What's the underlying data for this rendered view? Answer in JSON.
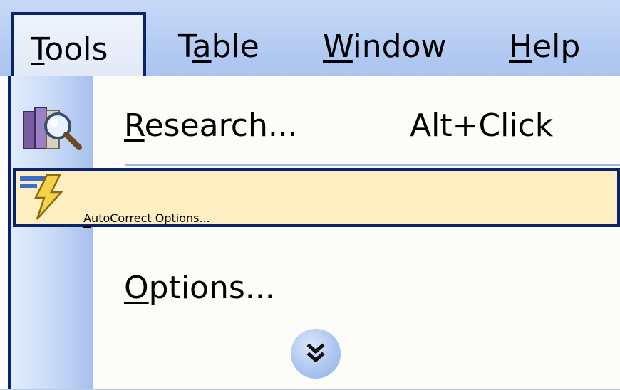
{
  "menubar": {
    "items": [
      {
        "label_pre": "",
        "label_mnemonic": "T",
        "label_post": "ools",
        "active": true
      },
      {
        "label_pre": "T",
        "label_mnemonic": "a",
        "label_post": "ble",
        "active": false
      },
      {
        "label_pre": "",
        "label_mnemonic": "W",
        "label_post": "indow",
        "active": false
      },
      {
        "label_pre": "",
        "label_mnemonic": "H",
        "label_post": "elp",
        "active": false
      }
    ]
  },
  "dropdown": {
    "items": [
      {
        "label_mnemonic": "R",
        "label_rest": "esearch...",
        "shortcut": "Alt+Click",
        "icon": "research-icon",
        "highlighted": false
      },
      {
        "label_mnemonic": "A",
        "label_rest": "utoCorrect Options...",
        "shortcut": "",
        "icon": "autocorrect-lightning-icon",
        "highlighted": true
      },
      {
        "label_mnemonic": "O",
        "label_rest": "ptions...",
        "shortcut": "",
        "icon": "",
        "highlighted": false
      }
    ],
    "expand_icon": "double-chevron-down-icon"
  },
  "colors": {
    "menubar": "#a9c4f0",
    "highlight_fill": "#ffeec2",
    "highlight_border": "#0a246a",
    "icon_strip": "#c6d8f5"
  }
}
